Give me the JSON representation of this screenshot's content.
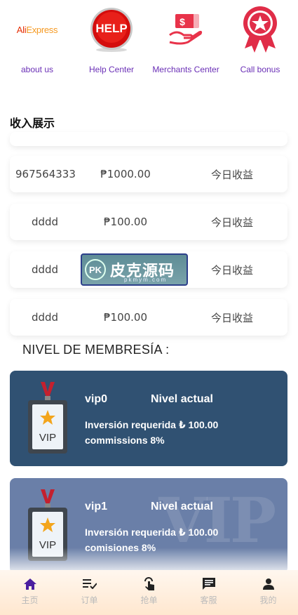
{
  "quick_menu": [
    {
      "label": "about us",
      "icon": "aliexpress-logo-icon",
      "logo_text_a": "Ali",
      "logo_text_b": "Express"
    },
    {
      "label": "Help Center",
      "icon": "help-button-icon",
      "logo_text": "HELP"
    },
    {
      "label": "Merchants Center",
      "icon": "money-hand-icon",
      "logo_text": "$"
    },
    {
      "label": "Call bonus",
      "icon": "star-medal-icon"
    }
  ],
  "income": {
    "title": "收入展示",
    "rows": [
      {
        "account": "967564333",
        "amount": "₱1000.00",
        "type": "今日收益"
      },
      {
        "account": "dddd",
        "amount": "₱100.00",
        "type": "今日收益"
      },
      {
        "account": "dddd",
        "amount": "",
        "type": "今日收益"
      },
      {
        "account": "dddd",
        "amount": "₱100.00",
        "type": "今日收益"
      }
    ]
  },
  "watermark": {
    "badge": "PK",
    "text": "皮克源码",
    "sub": "pkmym.com"
  },
  "membership": {
    "title": "NIVEL DE MEMBRESÍA :",
    "cards": [
      {
        "name": "vip0",
        "status": "Nivel actual",
        "line1": "Inversión requerida ₺ 100.00",
        "line2": "commissions 8%",
        "badge_text": "VIP"
      },
      {
        "name": "vip1",
        "status": "Nivel actual",
        "line1": "Inversión requerida ₺ 100.00",
        "line2": "comisiones 8%",
        "badge_text": "VIP",
        "bg_text": "VIP"
      }
    ]
  },
  "tabbar": [
    {
      "label": "主页",
      "icon": "home-icon",
      "active": true
    },
    {
      "label": "订单",
      "icon": "checklist-icon"
    },
    {
      "label": "抢单",
      "icon": "tap-hand-icon"
    },
    {
      "label": "客服",
      "icon": "chat-icon"
    },
    {
      "label": "我的",
      "icon": "person-icon"
    }
  ],
  "colors": {
    "accent": "#6a2fb6",
    "card0": "#305172",
    "card1": "#6a7fa8",
    "tab_active": "#4b1fa0"
  }
}
